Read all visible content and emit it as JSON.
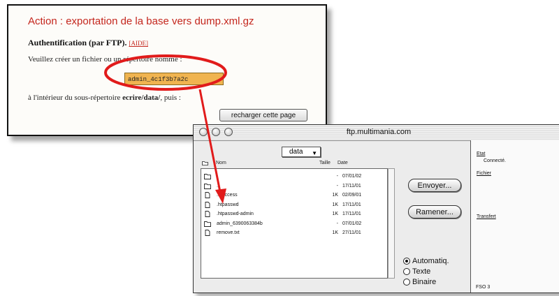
{
  "web_page": {
    "title": "Action : exportation de la base vers dump.xml.gz",
    "auth_heading": "Authentification (par FTP).",
    "help_link": "[AIDE]",
    "instruction": "Veuillez créer un fichier ou un répertoire nommé :",
    "filename_value": "admin_4c1f3b7a2c",
    "subdir_prefix": "à l'intérieur du sous-répertoire",
    "subdir_name": "ecrire/data/",
    "subdir_suffix": ", puis :",
    "reload_button": "recharger cette page"
  },
  "ftp": {
    "window_title": "ftp.multimania.com",
    "directory": "data",
    "columns": {
      "name": "Nom",
      "size": "Taille",
      "date": "Date"
    },
    "files": [
      {
        "icon": "folder-icon",
        "name": ".",
        "size": "-",
        "date": "07/01/02"
      },
      {
        "icon": "folder-icon",
        "name": "..",
        "size": "-",
        "date": "17/11/01"
      },
      {
        "icon": "file-icon",
        "name": ".htaccess",
        "size": "1K",
        "date": "02/09/01"
      },
      {
        "icon": "file-icon",
        "name": ".htpasswd",
        "size": "1K",
        "date": "17/11/01"
      },
      {
        "icon": "file-icon",
        "name": ".htpasswd-admin",
        "size": "1K",
        "date": "17/11/01"
      },
      {
        "icon": "folder-icon",
        "name": "admin_6390063384b",
        "size": "-",
        "date": "07/01/02"
      },
      {
        "icon": "file-icon",
        "name": "remove.txt",
        "size": "1K",
        "date": "27/11/01"
      }
    ],
    "send_button": "Envoyer...",
    "retrieve_button": "Ramener...",
    "transfer_modes": [
      {
        "label": "Automatiq.",
        "selected": true
      },
      {
        "label": "Texte",
        "selected": false
      },
      {
        "label": "Binaire",
        "selected": false
      }
    ],
    "side": {
      "state_label": "Etat",
      "state_value": "Connecté.",
      "file_label": "Fichier",
      "transfer_label": "Transfert"
    },
    "version": "FSO 3"
  },
  "colors": {
    "title_red": "#c4261d",
    "highlight": "#f0b450",
    "annotation_red": "#e11b1b"
  }
}
